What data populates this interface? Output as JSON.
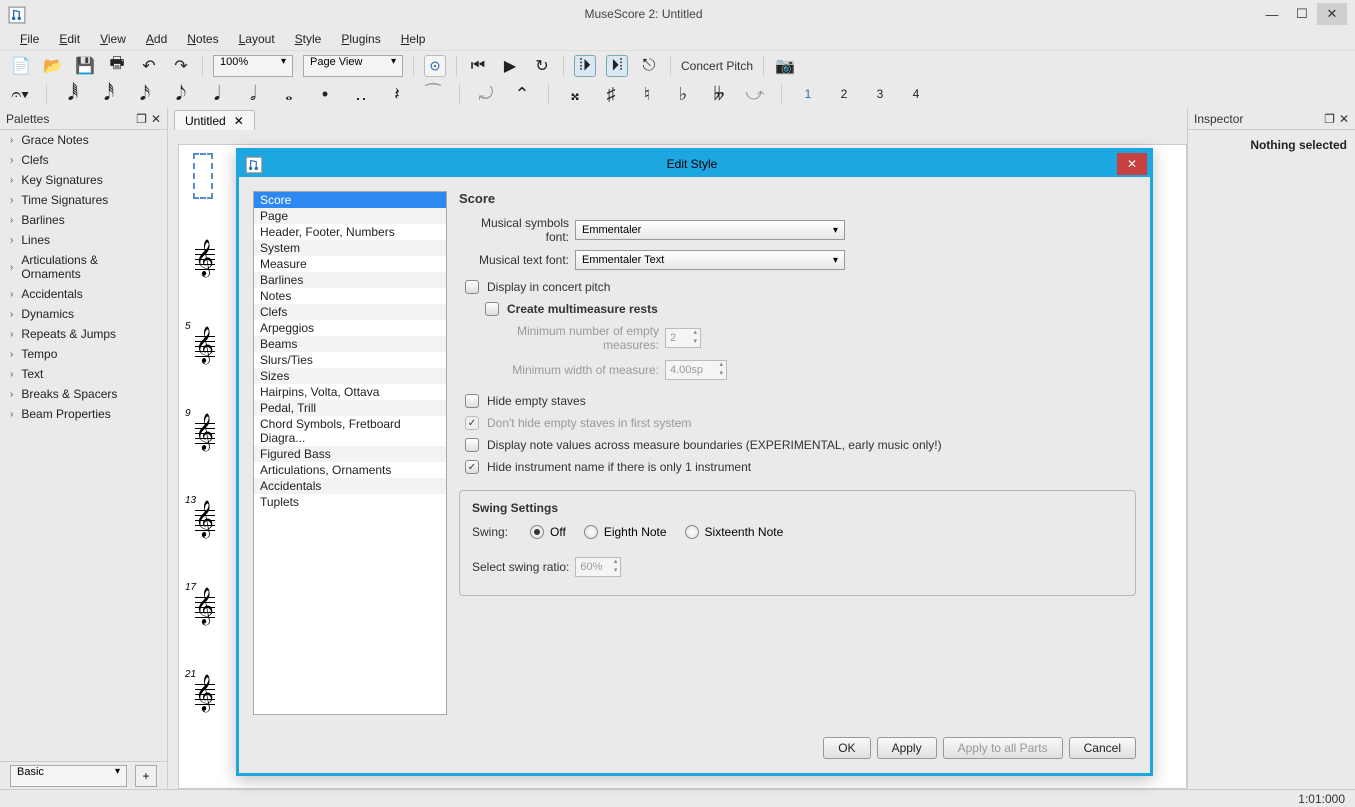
{
  "window": {
    "title": "MuseScore 2: Untitled"
  },
  "menus": [
    "File",
    "Edit",
    "View",
    "Add",
    "Notes",
    "Layout",
    "Style",
    "Plugins",
    "Help"
  ],
  "toolbar": {
    "zoom": "100%",
    "view_mode": "Page View",
    "concert_pitch": "Concert Pitch"
  },
  "note_toolbar_numbers": [
    "1",
    "2",
    "3",
    "4"
  ],
  "palettes": {
    "title": "Palettes",
    "items": [
      "Grace Notes",
      "Clefs",
      "Key Signatures",
      "Time Signatures",
      "Barlines",
      "Lines",
      "Articulations & Ornaments",
      "Accidentals",
      "Dynamics",
      "Repeats & Jumps",
      "Tempo",
      "Text",
      "Breaks & Spacers",
      "Beam Properties"
    ],
    "footer_select": "Basic"
  },
  "tabs": [
    {
      "label": "Untitled"
    }
  ],
  "score": {
    "measure_numbers": [
      "5",
      "9",
      "13",
      "17",
      "21"
    ]
  },
  "inspector": {
    "title": "Inspector",
    "empty_text": "Nothing selected"
  },
  "status": {
    "time": "1:01:000"
  },
  "dialog": {
    "title": "Edit Style",
    "categories": [
      "Score",
      "Page",
      "Header, Footer, Numbers",
      "System",
      "Measure",
      "Barlines",
      "Notes",
      "Clefs",
      "Arpeggios",
      "Beams",
      "Slurs/Ties",
      "Sizes",
      "Hairpins, Volta, Ottava",
      "Pedal, Trill",
      "Chord Symbols, Fretboard Diagra...",
      "Figured Bass",
      "Articulations, Ornaments",
      "Accidentals",
      "Tuplets"
    ],
    "selected_category": "Score",
    "section_title": "Score",
    "musical_symbols_font_label": "Musical symbols font:",
    "musical_symbols_font": "Emmentaler",
    "musical_text_font_label": "Musical text font:",
    "musical_text_font": "Emmentaler Text",
    "display_concert_pitch": "Display in concert pitch",
    "create_multimeasure": "Create multimeasure rests",
    "min_empty_label": "Minimum number of empty measures:",
    "min_empty_value": "2",
    "min_width_label": "Minimum width of measure:",
    "min_width_value": "4.00sp",
    "hide_empty_staves": "Hide empty staves",
    "dont_hide_first": "Don't hide empty staves in first system",
    "experimental": "Display note values across measure boundaries (EXPERIMENTAL, early music only!)",
    "hide_instrument": "Hide instrument name if there is only 1 instrument",
    "swing_title": "Swing Settings",
    "swing_label": "Swing:",
    "swing_options": [
      "Off",
      "Eighth Note",
      "Sixteenth Note"
    ],
    "swing_ratio_label": "Select swing ratio:",
    "swing_ratio_value": "60%",
    "buttons": {
      "ok": "OK",
      "apply": "Apply",
      "apply_all": "Apply to all Parts",
      "cancel": "Cancel"
    }
  }
}
